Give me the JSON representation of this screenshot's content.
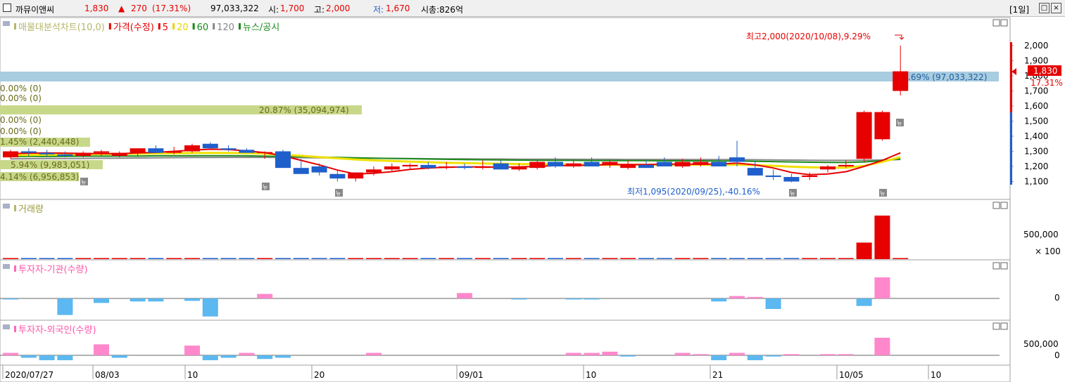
{
  "header": {
    "name": "까뮤이앤씨",
    "price": "1,830",
    "change_arrow": "▲",
    "change": "270",
    "change_pct": "(17.31%)",
    "volume": "97,033,322",
    "open_label": "시:",
    "open": "1,700",
    "high_label": "고:",
    "high": "2,000",
    "low_label": "저:",
    "low": "1,670",
    "mcap": "시총:826억",
    "period_button": "[1일]"
  },
  "colors": {
    "up": "#e60000",
    "down": "#1f5fcc",
    "ma5": "#e60000",
    "ma20": "#f0e000",
    "ma60": "#1a8a1a",
    "ma120": "#888888",
    "institution_pos": "#ff88cc",
    "institution_neg": "#5bb8f0",
    "volume_profile": "#c8d88a",
    "volume_profile_current": "#a8cce0"
  },
  "price_panel": {
    "legend": [
      {
        "label": "매물대분석차트(10,0)",
        "color": "#b5b56a"
      },
      {
        "label": "가격(수정)",
        "color": "#e60000"
      },
      {
        "label": "5",
        "color": "#e60000"
      },
      {
        "label": "20",
        "color": "#e6d600"
      },
      {
        "label": "60",
        "color": "#1a8a1a"
      },
      {
        "label": "120",
        "color": "#888888"
      },
      {
        "label": "뉴스/공시",
        "color": "#1a8a1a"
      }
    ],
    "high_annotation": "최고2,000(2020/10/08),9.29%",
    "low_annotation": "최저1,095(2020/09/25),-40.16%",
    "current_price_tag": "1,830",
    "current_pct_tag": "17.31%",
    "news_marker": "뉴",
    "volume_profile_labels": [
      ".69% (97,033,322)",
      "0.00% (0)",
      "0.00% (0)",
      "20.87% (35,094,974)",
      "0.00% (0)",
      "0.00% (0)",
      "1.45% (2,440,448)",
      "5.94% (9,983,051)",
      "4.14% (6,956,853)"
    ]
  },
  "panels": {
    "volume": {
      "title": "거래량",
      "tick": "500,000",
      "unit": "× 100"
    },
    "institution": {
      "title": "투자자-기관(수량)",
      "tick": "0"
    },
    "foreign": {
      "title": "투자자-외국인(수량)",
      "tick_top": "500,000",
      "tick_zero": "0"
    }
  },
  "x_axis_labels": [
    "2020/07/27",
    "08/03",
    "10",
    "20",
    "09/01",
    "10",
    "21",
    "10/05",
    "10"
  ],
  "chart_data": {
    "type": "candlestick",
    "ylim": [
      1050,
      2100
    ],
    "yticks": [
      1100,
      1200,
      1300,
      1400,
      1500,
      1600,
      1700,
      1800,
      1900,
      2000
    ],
    "dates": [
      "07/27",
      "07/28",
      "07/29",
      "07/30",
      "07/31",
      "08/03",
      "08/04",
      "08/05",
      "08/06",
      "08/07",
      "08/10",
      "08/11",
      "08/12",
      "08/13",
      "08/14",
      "08/18",
      "08/19",
      "08/20",
      "08/21",
      "08/24",
      "08/25",
      "08/26",
      "08/27",
      "08/28",
      "08/31",
      "09/01",
      "09/02",
      "09/03",
      "09/04",
      "09/07",
      "09/08",
      "09/09",
      "09/10",
      "09/11",
      "09/14",
      "09/15",
      "09/16",
      "09/17",
      "09/18",
      "09/21",
      "09/22",
      "09/23",
      "09/24",
      "09/25",
      "09/28",
      "09/29",
      "10/05",
      "10/06",
      "10/07",
      "10/08"
    ],
    "open": [
      1260,
      1300,
      1290,
      1280,
      1270,
      1290,
      1270,
      1290,
      1320,
      1290,
      1300,
      1350,
      1320,
      1310,
      1290,
      1300,
      1190,
      1200,
      1150,
      1120,
      1160,
      1180,
      1200,
      1210,
      1190,
      1200,
      1190,
      1220,
      1180,
      1190,
      1230,
      1200,
      1230,
      1210,
      1190,
      1210,
      1230,
      1200,
      1210,
      1230,
      1260,
      1190,
      1140,
      1130,
      1130,
      1180,
      1200,
      1250,
      1380,
      1700
    ],
    "high": [
      1310,
      1320,
      1310,
      1300,
      1300,
      1310,
      1300,
      1310,
      1340,
      1330,
      1350,
      1360,
      1340,
      1320,
      1300,
      1310,
      1250,
      1220,
      1180,
      1160,
      1200,
      1220,
      1220,
      1230,
      1230,
      1220,
      1240,
      1240,
      1220,
      1240,
      1260,
      1240,
      1260,
      1240,
      1240,
      1240,
      1260,
      1250,
      1260,
      1270,
      1370,
      1230,
      1180,
      1150,
      1160,
      1210,
      1240,
      1570,
      1570,
      2000
    ],
    "low": [
      1250,
      1270,
      1270,
      1260,
      1260,
      1270,
      1260,
      1270,
      1300,
      1280,
      1290,
      1320,
      1300,
      1290,
      1250,
      1190,
      1160,
      1140,
      1100,
      1100,
      1140,
      1170,
      1180,
      1180,
      1180,
      1180,
      1180,
      1190,
      1170,
      1180,
      1190,
      1190,
      1200,
      1190,
      1180,
      1190,
      1210,
      1190,
      1200,
      1200,
      1200,
      1140,
      1110,
      1095,
      1110,
      1160,
      1190,
      1230,
      1370,
      1670
    ],
    "close": [
      1300,
      1290,
      1280,
      1270,
      1290,
      1300,
      1290,
      1320,
      1290,
      1300,
      1340,
      1320,
      1310,
      1290,
      1295,
      1190,
      1150,
      1160,
      1120,
      1160,
      1180,
      1200,
      1210,
      1190,
      1200,
      1190,
      1200,
      1180,
      1200,
      1230,
      1200,
      1220,
      1200,
      1230,
      1210,
      1190,
      1200,
      1230,
      1230,
      1200,
      1230,
      1140,
      1130,
      1100,
      1140,
      1200,
      1210,
      1560,
      1560,
      1830
    ],
    "volume": [
      6000,
      5000,
      5000,
      4000,
      5000,
      5000,
      4000,
      6000,
      8000,
      5000,
      9000,
      7000,
      5000,
      4000,
      5000,
      9000,
      6000,
      4000,
      5000,
      4000,
      5000,
      4000,
      4000,
      4000,
      4000,
      4000,
      4000,
      4000,
      4000,
      4000,
      5000,
      4000,
      5000,
      4000,
      4000,
      4000,
      5000,
      4000,
      4000,
      5000,
      14000,
      6000,
      6000,
      5000,
      4000,
      5000,
      6000,
      300000,
      790000,
      0
    ],
    "institution": [
      -2000,
      0,
      0,
      -55000,
      0,
      -15000,
      0,
      -10000,
      -10000,
      0,
      -8000,
      -60000,
      0,
      0,
      15000,
      0,
      0,
      0,
      0,
      0,
      0,
      0,
      0,
      0,
      0,
      18000,
      0,
      0,
      -2000,
      0,
      0,
      -2000,
      -3000,
      0,
      0,
      0,
      0,
      0,
      0,
      -10000,
      8000,
      5000,
      -35000,
      0,
      0,
      0,
      0,
      -25000,
      70000,
      0
    ],
    "foreign": [
      10000,
      -10000,
      -20000,
      -20000,
      0,
      45000,
      -10000,
      0,
      0,
      0,
      40000,
      -20000,
      -10000,
      10000,
      -15000,
      -10000,
      0,
      0,
      0,
      0,
      10000,
      0,
      0,
      0,
      0,
      0,
      0,
      0,
      0,
      0,
      0,
      10000,
      10000,
      15000,
      -5000,
      0,
      0,
      10000,
      5000,
      -20000,
      10000,
      -20000,
      -5000,
      5000,
      0,
      5000,
      5000,
      0,
      72000,
      0
    ],
    "ma5": [
      1285,
      1288,
      1290,
      1288,
      1286,
      1285,
      1284,
      1290,
      1293,
      1300,
      1308,
      1314,
      1312,
      1303,
      1291,
      1270,
      1240,
      1210,
      1176,
      1150,
      1155,
      1165,
      1180,
      1190,
      1195,
      1197,
      1197,
      1195,
      1197,
      1200,
      1205,
      1206,
      1209,
      1212,
      1213,
      1212,
      1215,
      1215,
      1215,
      1216,
      1222,
      1210,
      1190,
      1160,
      1145,
      1150,
      1165,
      1200,
      1240,
      1290
    ],
    "ma20": [
      1275,
      1276,
      1277,
      1278,
      1280,
      1282,
      1283,
      1284,
      1286,
      1287,
      1289,
      1290,
      1290,
      1288,
      1284,
      1278,
      1270,
      1262,
      1254,
      1246,
      1240,
      1236,
      1232,
      1228,
      1224,
      1222,
      1220,
      1218,
      1216,
      1215,
      1214,
      1212,
      1210,
      1210,
      1210,
      1210,
      1210,
      1211,
      1211,
      1210,
      1212,
      1208,
      1204,
      1198,
      1194,
      1192,
      1191,
      1204,
      1230,
      1262
    ],
    "ma60": [
      1265,
      1266,
      1266,
      1267,
      1268,
      1268,
      1269,
      1269,
      1270,
      1270,
      1271,
      1271,
      1271,
      1270,
      1268,
      1266,
      1264,
      1262,
      1260,
      1257,
      1255,
      1253,
      1251,
      1249,
      1247,
      1245,
      1244,
      1243,
      1242,
      1241,
      1240,
      1240,
      1239,
      1239,
      1238,
      1238,
      1237,
      1237,
      1237,
      1236,
      1236,
      1234,
      1232,
      1230,
      1228,
      1227,
      1226,
      1230,
      1238,
      1250
    ],
    "ma120": [
      1250,
      1251,
      1252,
      1252,
      1253,
      1254,
      1255,
      1256,
      1257,
      1258,
      1259,
      1259,
      1260,
      1260,
      1260,
      1259,
      1258,
      1257,
      1256,
      1255,
      1254,
      1253,
      1252,
      1251,
      1250,
      1250,
      1249,
      1249,
      1248,
      1248,
      1248,
      1247,
      1247,
      1247,
      1246,
      1246,
      1246,
      1246,
      1245,
      1245,
      1245,
      1244,
      1243,
      1242,
      1241,
      1240,
      1240,
      1241,
      1243,
      1246
    ]
  }
}
